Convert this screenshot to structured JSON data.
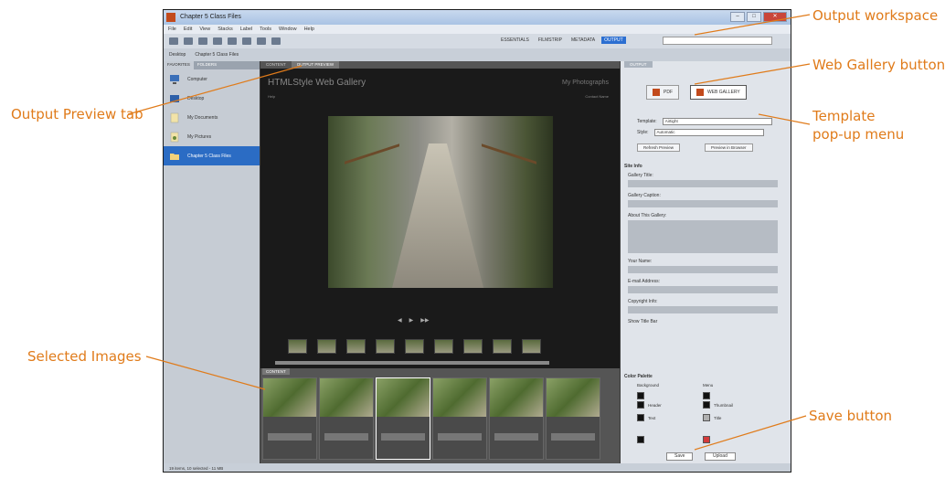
{
  "callouts": {
    "output_workspace": "Output workspace",
    "web_gallery_button": "Web Gallery button",
    "output_preview_tab": "Output Preview tab",
    "template_line1": "Template",
    "template_line2": "pop-up menu",
    "selected_images": "Selected Images",
    "save_button": "Save button"
  },
  "window": {
    "title": "Chapter 5 Class Files",
    "minimize": "–",
    "maximize": "□",
    "close": "✕"
  },
  "menu": [
    "File",
    "Edit",
    "View",
    "Stacks",
    "Label",
    "Tools",
    "Window",
    "Help"
  ],
  "workspaces": [
    "ESSENTIALS",
    "FILMSTRIP",
    "METADATA",
    "OUTPUT"
  ],
  "path": [
    "Desktop",
    "Chapter 5 Class Files"
  ],
  "left_panel": {
    "tabs": [
      "FAVORITES",
      "FOLDERS"
    ],
    "folders": [
      {
        "label": "Computer",
        "selected": false
      },
      {
        "label": "Desktop",
        "selected": false
      },
      {
        "label": "My Documents",
        "selected": false
      },
      {
        "label": "My Pictures",
        "selected": false
      },
      {
        "label": "Chapter 5 Class Files",
        "selected": true
      }
    ]
  },
  "center": {
    "tabs": [
      "CONTENT",
      "OUTPUT PREVIEW"
    ],
    "gallery_title": "HTMLStyle Web Gallery",
    "gallery_subtitle": "My Photographs",
    "gallery_link": "Help",
    "contact_link": "Contact Name",
    "favorites_tab": "CONTENT",
    "thumb_count": 9,
    "fav_count": 6
  },
  "right_panel": {
    "tab": "OUTPUT",
    "pdf_label": "PDF",
    "web_gallery_label": "WEB GALLERY",
    "template_label": "Template:",
    "template_value": "Airtight",
    "style_label": "Style:",
    "style_value": "Automatic",
    "refresh_preview": "Refresh Preview",
    "preview_browser": "Preview in Browser",
    "site_info": "Site Info",
    "gallery_title_label": "Gallery Title:",
    "gallery_caption_label": "Gallery Caption:",
    "about_label": "About This Gallery:",
    "your_name_label": "Your Name:",
    "email_label": "E-mail Address:",
    "copyright_label": "Copyright Info:",
    "show_title_bar": "Show Title Bar",
    "color_palette": "Color Palette",
    "background_label": "Background",
    "menu_label": "Menu",
    "header_label": "Header",
    "thumbnail_label": "Thumbnail",
    "text_label": "Text",
    "title_label": "Title",
    "save": "Save",
    "upload": "Upload"
  },
  "status": "19 items, 10 selected - 11 MB"
}
